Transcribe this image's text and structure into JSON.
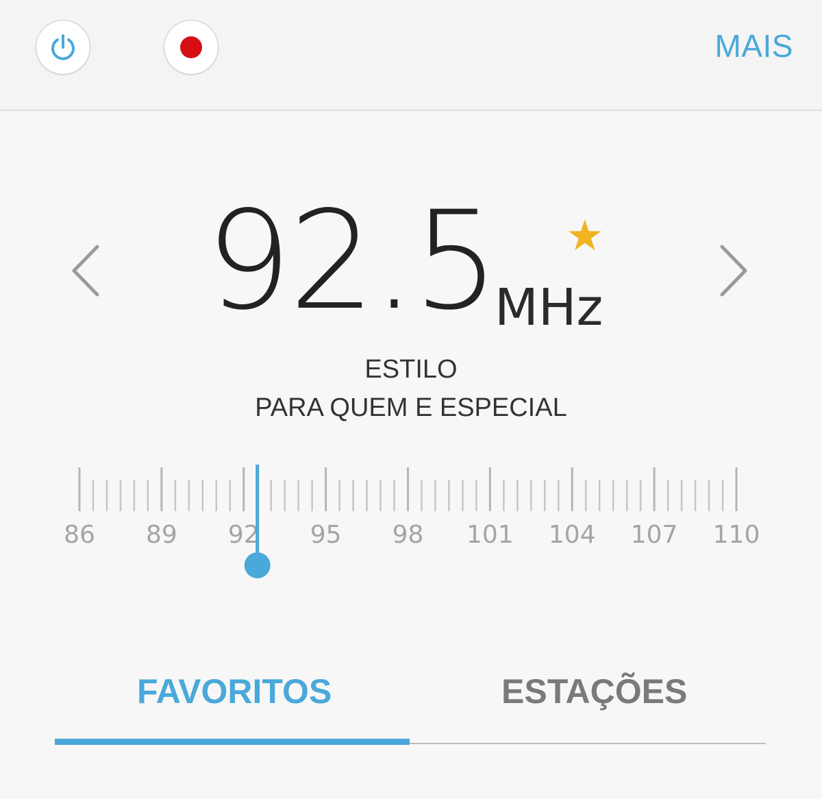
{
  "topbar": {
    "power_icon": "power-icon",
    "record_icon": "record-dot-icon",
    "more_label": "MAIS"
  },
  "tuner": {
    "frequency": "92.5",
    "unit": "MHz",
    "favorite_icon": "star-icon",
    "station_name": "ESTILO",
    "station_text": "PARA QUEM E ESPECIAL",
    "scale_labels": [
      "86",
      "89",
      "92",
      "95",
      "98",
      "101",
      "104",
      "107",
      "110"
    ],
    "scale_min": 86,
    "scale_max": 110,
    "current_value": 92.5
  },
  "tabs": {
    "favorites_label": "FAVORITOS",
    "stations_label": "ESTAÇÕES",
    "active": "favorites"
  },
  "colors": {
    "accent": "#4aa8da",
    "record": "#d50f14",
    "star": "#f1b320"
  }
}
